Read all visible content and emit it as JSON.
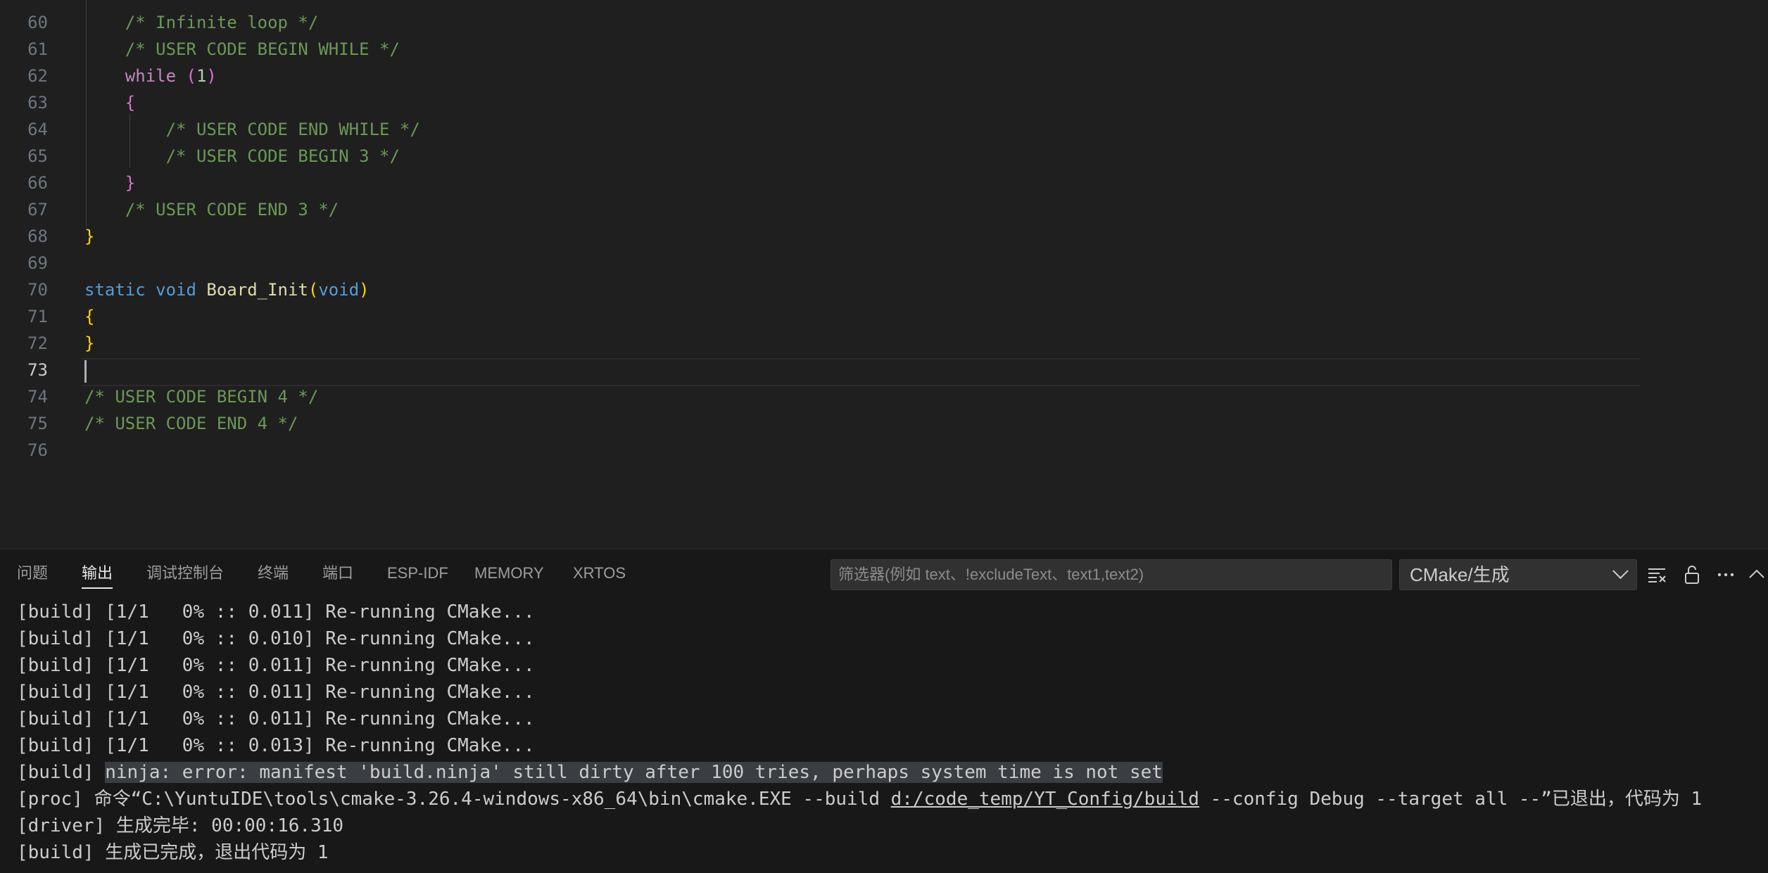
{
  "editor": {
    "lines": [
      {
        "num": "60",
        "tokens": [
          {
            "t": "    "
          },
          {
            "t": "/* Infinite loop */",
            "c": "t-com"
          }
        ]
      },
      {
        "num": "61",
        "tokens": [
          {
            "t": "    "
          },
          {
            "t": "/* USER CODE BEGIN WHILE */",
            "c": "t-com"
          }
        ]
      },
      {
        "num": "62",
        "tokens": [
          {
            "t": "    "
          },
          {
            "t": "while",
            "c": "t-ctl"
          },
          {
            "t": " "
          },
          {
            "t": "(",
            "c": "b2"
          },
          {
            "t": "1",
            "c": "t-num"
          },
          {
            "t": ")",
            "c": "b2"
          }
        ]
      },
      {
        "num": "63",
        "tokens": [
          {
            "t": "    "
          },
          {
            "t": "{",
            "c": "b2"
          }
        ]
      },
      {
        "num": "64",
        "tokens": [
          {
            "t": "        "
          },
          {
            "t": "/* USER CODE END WHILE */",
            "c": "t-com"
          }
        ]
      },
      {
        "num": "65",
        "tokens": [
          {
            "t": "        "
          },
          {
            "t": "/* USER CODE BEGIN 3 */",
            "c": "t-com"
          }
        ]
      },
      {
        "num": "66",
        "tokens": [
          {
            "t": "    "
          },
          {
            "t": "}",
            "c": "b2"
          }
        ]
      },
      {
        "num": "67",
        "tokens": [
          {
            "t": "    "
          },
          {
            "t": "/* USER CODE END 3 */",
            "c": "t-com"
          }
        ]
      },
      {
        "num": "68",
        "tokens": [
          {
            "t": "}",
            "c": "b1"
          }
        ]
      },
      {
        "num": "69",
        "tokens": []
      },
      {
        "num": "70",
        "tokens": [
          {
            "t": "static",
            "c": "t-kw"
          },
          {
            "t": " "
          },
          {
            "t": "void",
            "c": "t-kw"
          },
          {
            "t": " "
          },
          {
            "t": "Board_Init",
            "c": "t-fn"
          },
          {
            "t": "(",
            "c": "b1"
          },
          {
            "t": "void",
            "c": "t-kw"
          },
          {
            "t": ")",
            "c": "b1"
          }
        ]
      },
      {
        "num": "71",
        "tokens": [
          {
            "t": "{",
            "c": "b1"
          }
        ]
      },
      {
        "num": "72",
        "tokens": [
          {
            "t": "}",
            "c": "b1"
          }
        ]
      },
      {
        "num": "73",
        "tokens": [],
        "active": true
      },
      {
        "num": "74",
        "tokens": [
          {
            "t": "/* USER CODE BEGIN 4 */",
            "c": "t-com"
          }
        ]
      },
      {
        "num": "75",
        "tokens": [
          {
            "t": "/* USER CODE END 4 */",
            "c": "t-com"
          }
        ]
      },
      {
        "num": "76",
        "tokens": []
      }
    ]
  },
  "panel": {
    "tabs": [
      {
        "label": "问题",
        "name": "tab-problems"
      },
      {
        "label": "输出",
        "name": "tab-output",
        "active": true
      },
      {
        "label": "调试控制台",
        "name": "tab-debug-console"
      },
      {
        "label": "终端",
        "name": "tab-terminal"
      },
      {
        "label": "端口",
        "name": "tab-ports"
      },
      {
        "label": "ESP-IDF",
        "name": "tab-esp-idf"
      },
      {
        "label": "MEMORY",
        "name": "tab-memory"
      },
      {
        "label": "XRTOS",
        "name": "tab-xrtos"
      }
    ],
    "filter": {
      "placeholder": "筛选器(例如 text、!excludeText、text1,text2)",
      "value": ""
    },
    "output_channel": "CMake/生成",
    "icons": [
      "clear-output-icon",
      "lock-scroll-icon",
      "more-actions-icon",
      "maximize-panel-icon"
    ]
  },
  "output": {
    "lines": [
      {
        "parts": [
          {
            "t": "[build] [1/1   0% :: 0.011] Re-running CMake..."
          }
        ]
      },
      {
        "parts": [
          {
            "t": "[build] [1/1   0% :: 0.010] Re-running CMake..."
          }
        ]
      },
      {
        "parts": [
          {
            "t": "[build] [1/1   0% :: 0.011] Re-running CMake..."
          }
        ]
      },
      {
        "parts": [
          {
            "t": "[build] [1/1   0% :: 0.011] Re-running CMake..."
          }
        ]
      },
      {
        "parts": [
          {
            "t": "[build] [1/1   0% :: 0.011] Re-running CMake..."
          }
        ]
      },
      {
        "parts": [
          {
            "t": "[build] [1/1   0% :: 0.013] Re-running CMake..."
          }
        ]
      },
      {
        "parts": [
          {
            "t": "[build] "
          },
          {
            "t": "ninja: error: manifest 'build.ninja' still dirty after 100 tries, perhaps system time is not set",
            "c": "hl"
          }
        ]
      },
      {
        "parts": [
          {
            "t": "[proc] 命令“C:\\YuntuIDE\\tools\\cmake-3.26.4-windows-x86_64\\bin\\cmake.EXE --build "
          },
          {
            "t": "d:/code_temp/YT_Config/build",
            "c": "link"
          },
          {
            "t": " --config Debug --target all --”已退出，代码为 1"
          }
        ]
      },
      {
        "parts": [
          {
            "t": "[driver] 生成完毕: 00:00:16.310"
          }
        ]
      },
      {
        "parts": [
          {
            "t": "[build] 生成已完成，退出代码为 1"
          }
        ]
      }
    ]
  },
  "colors": {
    "editor_bg": "#1f1f1f",
    "panel_bg": "#181818",
    "comment": "#6a9955",
    "keyword": "#569cd6",
    "control": "#c586c0",
    "function": "#dcdcaa",
    "bracket_gold": "#ffd700",
    "bracket_orchid": "#da70d6"
  }
}
